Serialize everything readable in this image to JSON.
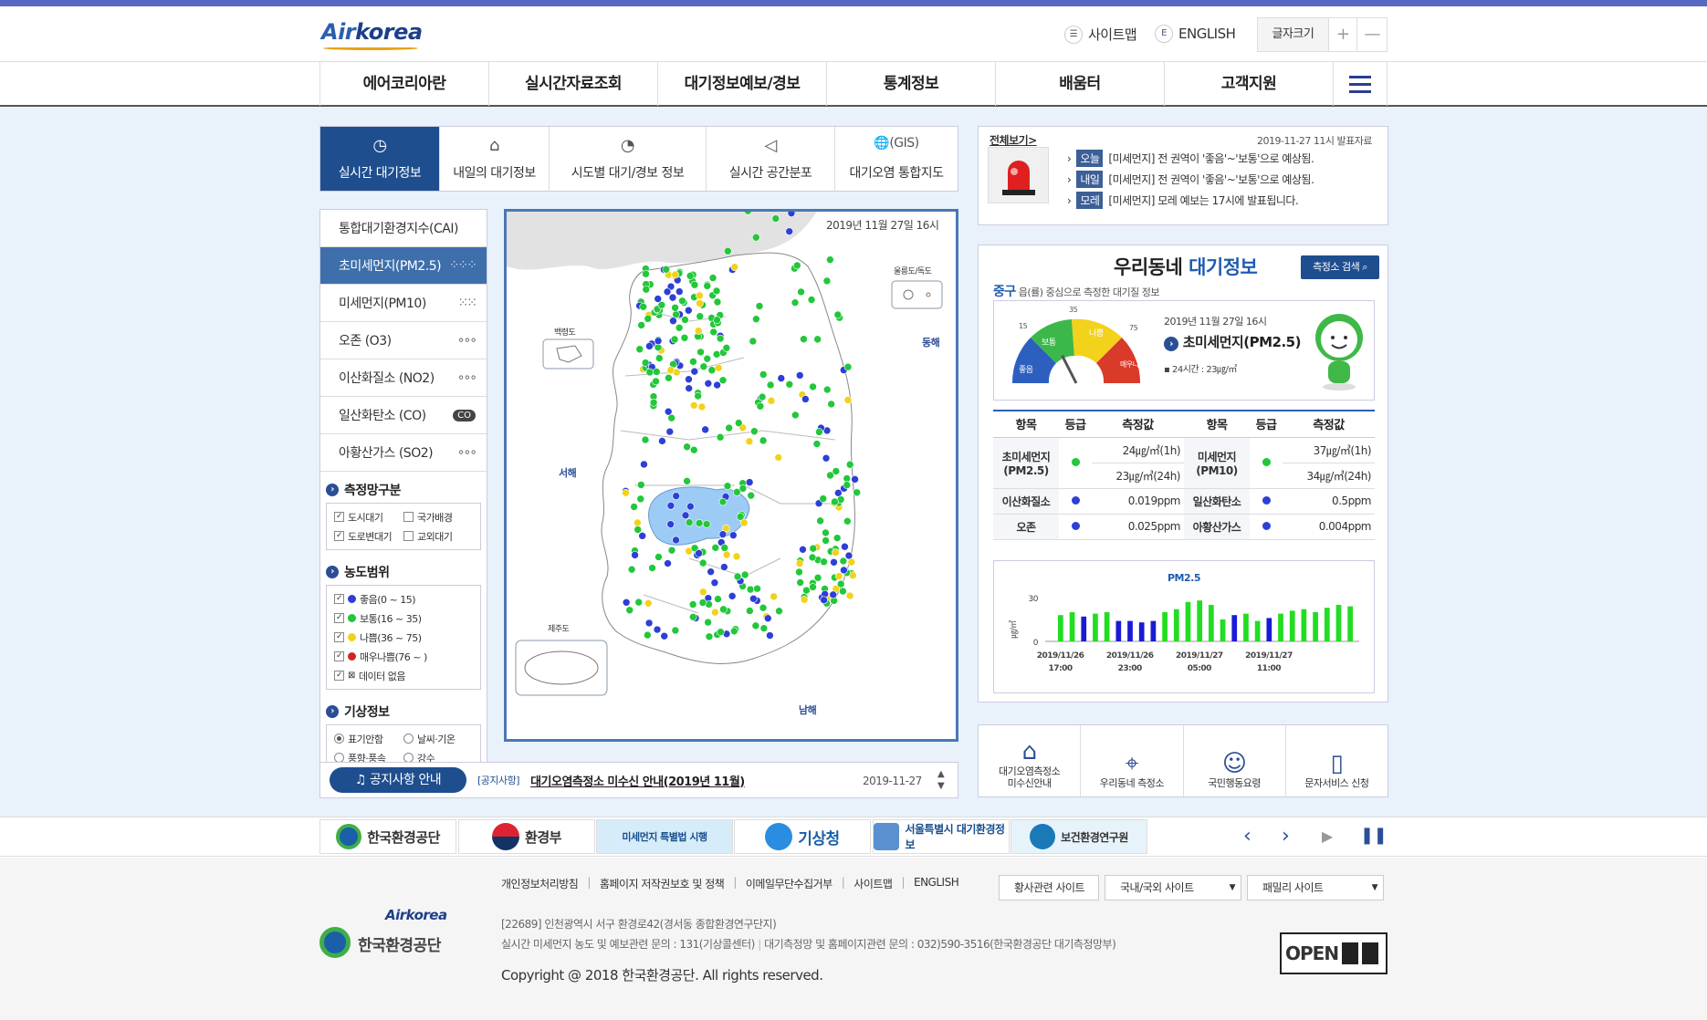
{
  "header": {
    "logo_air": "Air",
    "logo_korea": "korea",
    "sitemap": "사이트맵",
    "english": "ENGLISH",
    "english_badge": "E",
    "fontsize_label": "글자크기",
    "fontsize_plus": "+",
    "fontsize_minus": "—"
  },
  "gnb": [
    "에어코리아란",
    "실시간자료조회",
    "대기정보예보/경보",
    "통계정보",
    "배움터",
    "고객지원"
  ],
  "tabs": [
    {
      "label": "실시간 대기정보",
      "icon": "clock-icon",
      "glyph": "◷"
    },
    {
      "label": "내일의 대기정보",
      "icon": "location-icon",
      "glyph": "⌂"
    },
    {
      "label": "시도별 대기/경보 정보",
      "icon": "compass-icon",
      "glyph": "◔"
    },
    {
      "label": "실시간 공간분포",
      "icon": "megaphone-icon",
      "glyph": "◁"
    },
    {
      "label": "대기오염 통합지도",
      "icon": "globe-icon",
      "glyph": "(GIS)"
    }
  ],
  "leftnav": {
    "items": [
      {
        "label": "통합대기환경지수(CAI)",
        "dots": ""
      },
      {
        "label": "초미세먼지(PM2.5)",
        "dots": "⁘⁘⁘"
      },
      {
        "label": "미세먼지(PM10)",
        "dots": "⁙⁙"
      },
      {
        "label": "오존 (O3)",
        "dots": "∘∘∘"
      },
      {
        "label": "이산화질소 (NO2)",
        "dots": "∘∘∘"
      },
      {
        "label": "일산화탄소 (CO)",
        "dots": "CO"
      },
      {
        "label": "아황산가스 (SO2)",
        "dots": "∘∘∘"
      }
    ],
    "network_title": "측정망구분",
    "network": [
      "도시대기",
      "국가배경",
      "도로변대기",
      "교외대기"
    ],
    "range_title": "농도범위",
    "ranges": [
      {
        "label": "좋음(0 ~ 15)",
        "color": "#2d3fd6"
      },
      {
        "label": "보통(16 ~ 35)",
        "color": "#22c73a"
      },
      {
        "label": "나쁨(36 ~ 75)",
        "color": "#f2d21b"
      },
      {
        "label": "매우나쁨(76 ~ )",
        "color": "#d42525"
      },
      {
        "label": "데이터 없음",
        "color": "none"
      }
    ],
    "weather_title": "기상정보",
    "weather": [
      "표기안함",
      "날씨·기온",
      "풍향·풍속",
      "강수"
    ]
  },
  "map": {
    "date": "2019년 11월 27일 16시",
    "labels": {
      "baengnyeong": "백령도",
      "ulleung": "울릉도/독도",
      "jeju": "제주도",
      "west": "서해",
      "east": "동해",
      "south": "남해"
    }
  },
  "notice": {
    "button": "공지사항 안내",
    "tag": "[공지사항]",
    "title": "대기오염측정소 미수신 안내(2019년 11월)",
    "date": "2019-11-27"
  },
  "forecast": {
    "view_all": "전체보기>",
    "issued": "2019-11-27 11시 발표자료",
    "rows": [
      {
        "day": "오늘",
        "text": "[미세먼지] 전 권역이 '좋음'~'보통'으로 예상됨."
      },
      {
        "day": "내일",
        "text": "[미세먼지] 전 권역이 '좋음'~'보통'으로 예상됨."
      },
      {
        "day": "모레",
        "text": "[미세먼지] 모레 예보는 17시에 발표됩니다."
      }
    ]
  },
  "local": {
    "title_a": "우리동네 ",
    "title_b": "대기정보",
    "search": "측정소 검색",
    "district": "중구",
    "district_desc": " 읍(률) 중심으로 측정한 대기질 정보",
    "gauge": {
      "labels": [
        "좋음",
        "보통",
        "나쁨",
        "매우나쁨"
      ],
      "ticks": [
        "15",
        "35",
        "75"
      ],
      "datetime": "2019년 11월 27일 16시",
      "pollutant": "초미세먼지(PM2.5)",
      "avg": "24시간 : 23㎍/㎥",
      "value": 23
    },
    "table": {
      "headers": [
        "항목",
        "등급",
        "측정값",
        "항목",
        "등급",
        "측정값"
      ],
      "rows": [
        {
          "n1": "초미세먼지 (PM2.5)",
          "g1": "#22c73a",
          "v1a": "24㎍/㎥(1h)",
          "v1b": "23㎍/㎥(24h)",
          "n2": "미세먼지 (PM10)",
          "g2": "#22c73a",
          "v2a": "37㎍/㎥(1h)",
          "v2b": "34㎍/㎥(24h)"
        },
        {
          "n1": "이산화질소",
          "g1": "#2d3fd6",
          "v1a": "0.019ppm",
          "n2": "일산화탄소",
          "g2": "#2d3fd6",
          "v2a": "0.5ppm"
        },
        {
          "n1": "오존",
          "g1": "#2d3fd6",
          "v1a": "0.025ppm",
          "n2": "아황산가스",
          "g2": "#2d3fd6",
          "v2a": "0.004ppm"
        }
      ]
    }
  },
  "chart_data": {
    "type": "bar",
    "title": "PM2.5",
    "ylabel": "㎍/㎥",
    "ylim": [
      0,
      30
    ],
    "yticks": [
      "30",
      "0"
    ],
    "xticks": [
      [
        "2019/11/26",
        "17:00"
      ],
      [
        "2019/11/26",
        "23:00"
      ],
      [
        "2019/11/27",
        "05:00"
      ],
      [
        "2019/11/27",
        "11:00"
      ]
    ],
    "values": [
      18,
      20,
      17,
      19,
      20,
      14,
      14,
      13,
      14,
      20,
      22,
      27,
      28,
      25,
      15,
      18,
      19,
      14,
      16,
      19,
      21,
      22,
      20,
      23,
      25,
      24
    ],
    "colors": [
      "#22dd22",
      "#22dd22",
      "#1a1ad6",
      "#22dd22",
      "#22dd22",
      "#1a1ad6",
      "#1a1ad6",
      "#1a1ad6",
      "#1a1ad6",
      "#22dd22",
      "#22dd22",
      "#22dd22",
      "#22dd22",
      "#22dd22",
      "#22dd22",
      "#1a1ad6",
      "#22dd22",
      "#22dd22",
      "#1a1ad6",
      "#22dd22",
      "#22dd22",
      "#22dd22",
      "#22dd22",
      "#22dd22",
      "#22dd22",
      "#22dd22"
    ]
  },
  "quicklinks": [
    {
      "label": "대기오염측정소\n미수신안내",
      "icon": "house-signal-icon",
      "glyph": "⌂"
    },
    {
      "label": "우리동네 측정소",
      "icon": "map-pin-house-icon",
      "glyph": "⌖"
    },
    {
      "label": "국민행동요령",
      "icon": "person-icon",
      "glyph": "☺"
    },
    {
      "label": "문자서비스 신청",
      "icon": "phone-message-icon",
      "glyph": "▯"
    }
  ],
  "banners": [
    {
      "label": "한국환경공단",
      "icon": "keco-logo"
    },
    {
      "label": "환경부",
      "icon": "taegeuk-logo"
    },
    {
      "label": "미세먼지 특별법 시행",
      "icon": "campaign-banner"
    },
    {
      "label": "기상청",
      "icon": "kma-logo"
    },
    {
      "label": "서울특별시 대기환경정보",
      "icon": "seoul-logo"
    },
    {
      "label": "보건환경연구원",
      "icon": "incheon-logo"
    }
  ],
  "footer": {
    "links": [
      "개인정보처리방침",
      "홈페이지 저작권보호 및 정책",
      "이메일무단수집거부",
      "사이트맵",
      "ENGLISH"
    ],
    "selects": [
      "황사관련 사이트",
      "국내/국외 사이트",
      "패밀리 사이트"
    ],
    "address": "[22689] 인천광역시 서구 환경로42(경서동 종합환경연구단지)",
    "contact_a": "실시간 미세먼지 농도 및 예보관련 문의 : 131(기상콜센터)",
    "contact_b": "대기측정망 및 홈페이지관련 문의 : 032)590-3516(한국환경공단 대기측정망부)",
    "copyright": "Copyright @ 2018 한국환경공단. All rights reserved.",
    "org": "한국환경공단",
    "open": "OPEN"
  }
}
